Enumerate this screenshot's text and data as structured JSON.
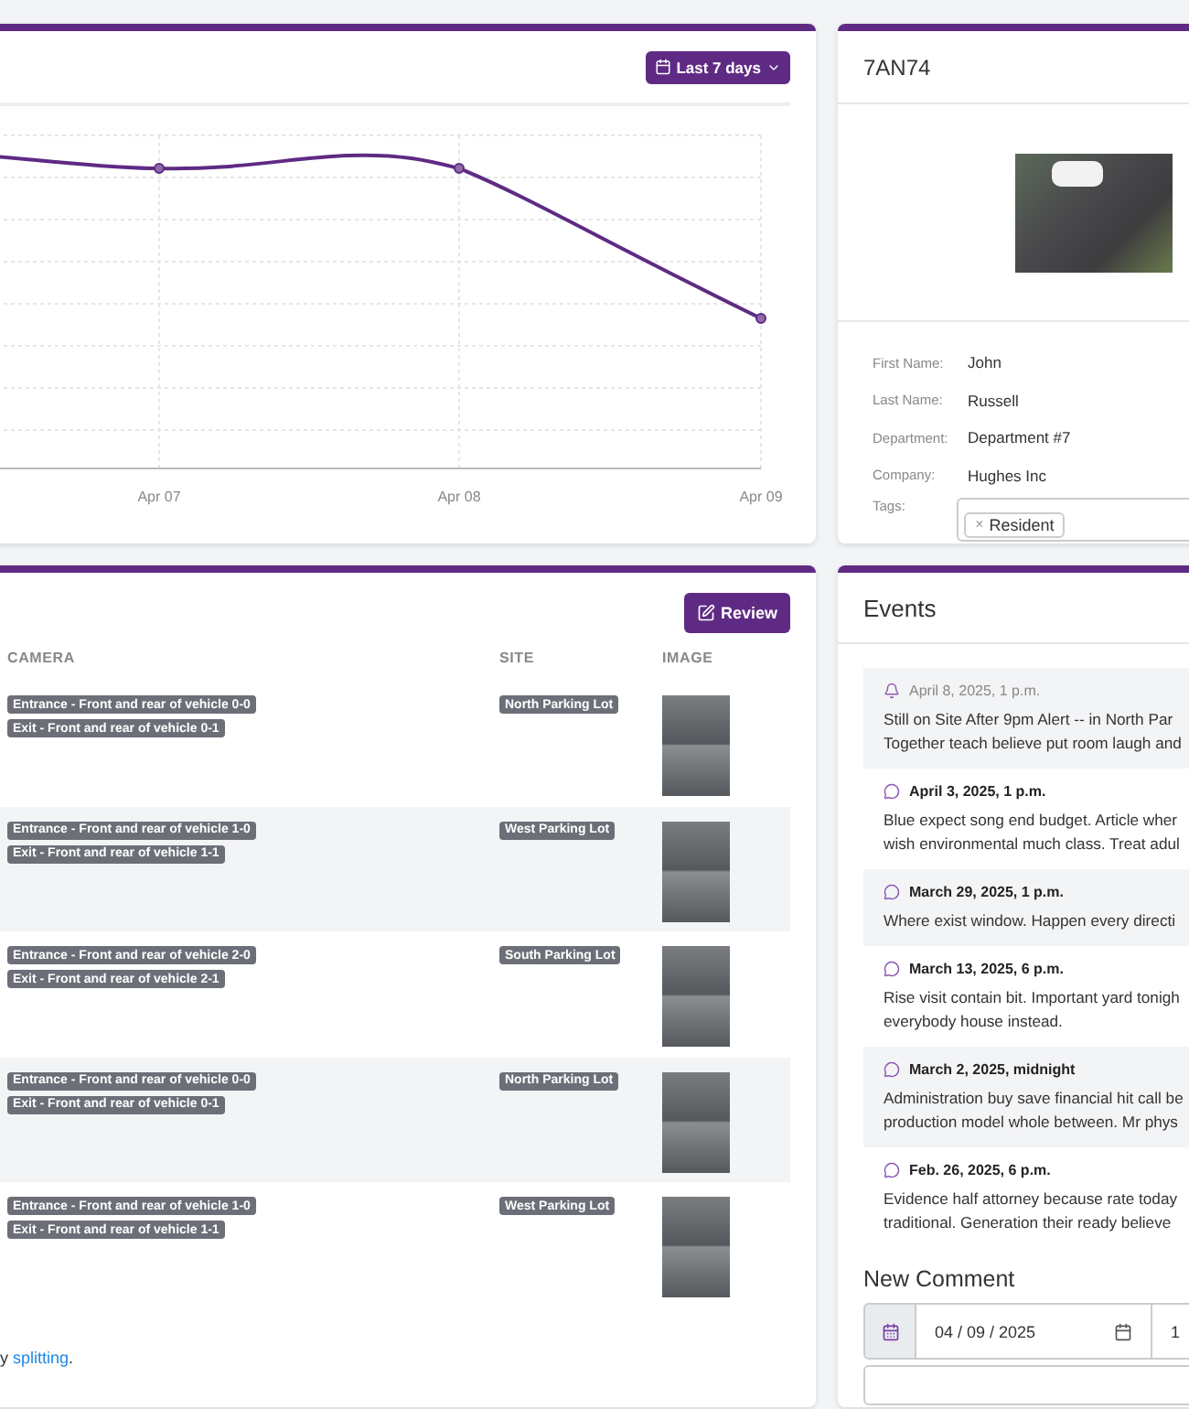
{
  "chart_card": {
    "range_button": "Last 7 days",
    "x_labels": [
      "Apr 07",
      "Apr 08",
      "Apr 09"
    ]
  },
  "vehicle": {
    "plate": "7AN74",
    "fields": [
      {
        "label": "First Name:",
        "value": "John"
      },
      {
        "label": "Last Name:",
        "value": "Russell"
      },
      {
        "label": "Department:",
        "value": "Department #7"
      },
      {
        "label": "Company:",
        "value": "Hughes Inc"
      }
    ],
    "tags_label": "Tags:",
    "tags": [
      "Resident"
    ],
    "tag_remove": "×"
  },
  "detections": {
    "review_button": "Review",
    "columns": [
      "CAMERA",
      "SITE",
      "IMAGE"
    ],
    "rows": [
      {
        "cameras": [
          "Entrance - Front and rear of vehicle 0-0",
          "Exit - Front and rear of vehicle 0-1"
        ],
        "site": "North Parking Lot"
      },
      {
        "cameras": [
          "Entrance - Front and rear of vehicle 1-0",
          "Exit - Front and rear of vehicle 1-1"
        ],
        "site": "West Parking Lot"
      },
      {
        "cameras": [
          "Entrance - Front and rear of vehicle 2-0",
          "Exit - Front and rear of vehicle 2-1"
        ],
        "site": "South Parking Lot"
      },
      {
        "cameras": [
          "Entrance - Front and rear of vehicle 0-0",
          "Exit - Front and rear of vehicle 0-1"
        ],
        "site": "North Parking Lot"
      },
      {
        "cameras": [
          "Entrance - Front and rear of vehicle 1-0",
          "Exit - Front and rear of vehicle 1-1"
        ],
        "site": "West Parking Lot"
      }
    ],
    "footer": {
      "before": "y",
      "link": "splitting",
      "after": "."
    }
  },
  "events": {
    "title": "Events",
    "items": [
      {
        "kind": "alert",
        "time": "April 8, 2025, 1 p.m.",
        "lines": [
          "Still on Site After 9pm Alert -- in North Par",
          "Together teach believe put room laugh and"
        ]
      },
      {
        "kind": "comment",
        "time": "April 3, 2025, 1 p.m.",
        "lines": [
          "Blue expect song end budget. Article wher",
          "wish environmental much class. Treat adul"
        ]
      },
      {
        "kind": "comment",
        "time": "March 29, 2025, 1 p.m.",
        "lines": [
          "Where exist window. Happen every directi"
        ]
      },
      {
        "kind": "comment",
        "time": "March 13, 2025, 6 p.m.",
        "lines": [
          "Rise visit contain bit. Important yard tonigh",
          "everybody house instead."
        ]
      },
      {
        "kind": "comment",
        "time": "March 2, 2025, midnight",
        "lines": [
          "Administration buy save financial hit call be",
          "production model whole between. Mr phys"
        ]
      },
      {
        "kind": "comment",
        "time": "Feb. 26, 2025, 6 p.m.",
        "lines": [
          "Evidence half attorney because rate today",
          "traditional. Generation their ready believe"
        ]
      }
    ],
    "new_comment": {
      "title": "New Comment",
      "date": "04 / 09 / 2025",
      "time": "1"
    }
  }
}
